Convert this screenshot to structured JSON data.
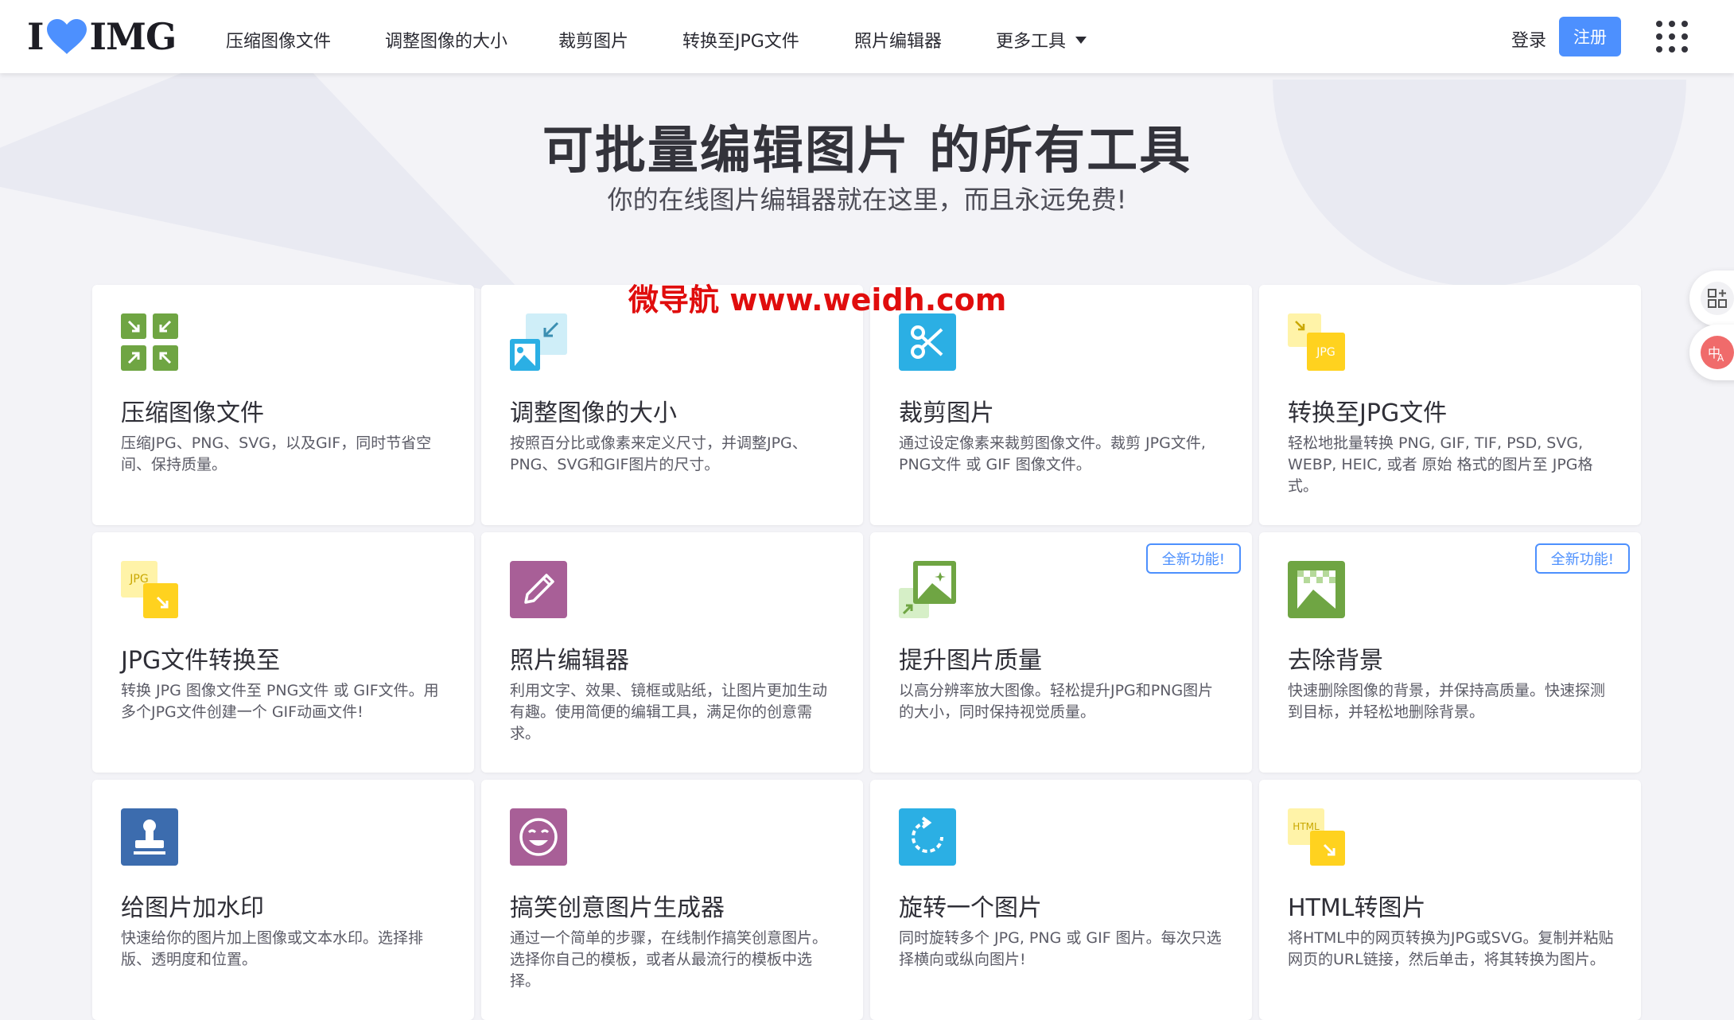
{
  "header": {
    "logo_left": "I",
    "logo_right": "IMG",
    "nav": [
      "压缩图像文件",
      "调整图像的大小",
      "裁剪图片",
      "转换至JPG文件",
      "照片编辑器",
      "更多工具"
    ],
    "login": "登录",
    "signup": "注册"
  },
  "hero": {
    "title": "可批量编辑图片 的所有工具",
    "subtitle": "你的在线图片编辑器就在这里，而且永远免费!"
  },
  "watermark": "微导航 www.weidh.com",
  "badge_label": "全新功能!",
  "tools": [
    {
      "title": "压缩图像文件",
      "desc": "压缩JPG、PNG、SVG，以及GIF，同时节省空间、保持质量。",
      "icon": "compress-icon"
    },
    {
      "title": "调整图像的大小",
      "desc": "按照百分比或像素来定义尺寸，并调整JPG、PNG、SVG和GIF图片的尺寸。",
      "icon": "resize-icon"
    },
    {
      "title": "裁剪图片",
      "desc": "通过设定像素来裁剪图像文件。裁剪 JPG文件, PNG文件 或 GIF 图像文件。",
      "icon": "crop-icon"
    },
    {
      "title": "转换至JPG文件",
      "desc": "轻松地批量转换 PNG, GIF, TIF, PSD, SVG, WEBP, HEIC, 或者 原始 格式的图片至 JPG格式。",
      "icon": "convert-to-jpg-icon"
    },
    {
      "title": "JPG文件转换至",
      "desc": "转换 JPG 图像文件至 PNG文件 或 GIF文件。用多个JPG文件创建一个 GIF动画文件!",
      "icon": "convert-from-jpg-icon"
    },
    {
      "title": "照片编辑器",
      "desc": "利用文字、效果、镜框或贴纸，让图片更加生动有趣。使用简便的编辑工具，满足你的创意需求。",
      "icon": "pencil-icon"
    },
    {
      "title": "提升图片质量",
      "desc": "以高分辨率放大图像。轻松提升JPG和PNG图片的大小，同时保持视觉质量。",
      "icon": "upscale-icon",
      "badge": true
    },
    {
      "title": "去除背景",
      "desc": "快速删除图像的背景，并保持高质量。快速探测到目标，并轻松地删除背景。",
      "icon": "remove-background-icon",
      "badge": true
    },
    {
      "title": "给图片加水印",
      "desc": "快速给你的图片加上图像或文本水印。选择排版、透明度和位置。",
      "icon": "stamp-icon"
    },
    {
      "title": "搞笑创意图片生成器",
      "desc": "通过一个简单的步骤，在线制作搞笑创意图片。选择你自己的模板，或者从最流行的模板中选择。",
      "icon": "meme-icon"
    },
    {
      "title": "旋转一个图片",
      "desc": "同时旋转多个 JPG, PNG 或 GIF 图片。每次只选择横向或纵向图片!",
      "icon": "rotate-icon"
    },
    {
      "title": "HTML转图片",
      "desc": "将HTML中的网页转换为JPG或SVG。复制并粘贴网页的URL链接，然后单击，将其转换为图片。",
      "icon": "html-to-image-icon"
    }
  ],
  "icon_labels": {
    "jpg": "JPG",
    "html": "HTML"
  },
  "colors": {
    "accent": "#4d90fe",
    "compress": "#6fa543",
    "resize": "#7ec8e3",
    "crop": "#2bafe4",
    "convert": "#ffd93b",
    "editor": "#a85f97",
    "watermark": "#3c6cae",
    "meme": "#a85f97",
    "rotate": "#2bafe4",
    "watermark_text": "#e00d0d"
  }
}
